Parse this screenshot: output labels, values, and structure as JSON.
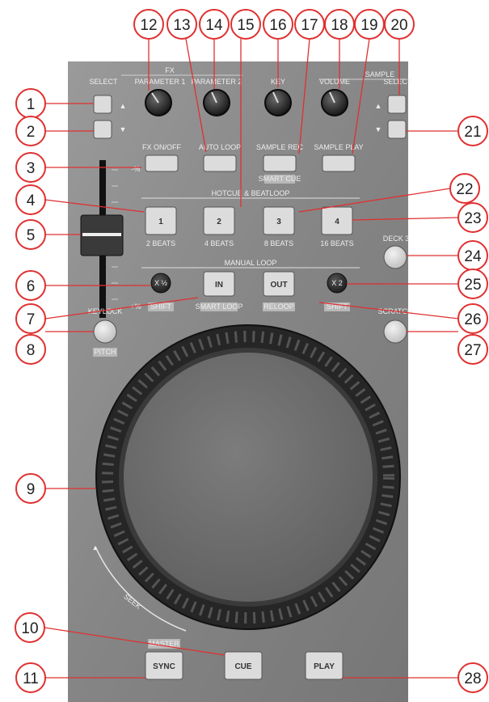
{
  "colors": {
    "panel": "#8a8a8a",
    "panel_dark": "#6f6f6f",
    "callout": "#e03030",
    "button": "#dcdcdc",
    "ring": "#2a2a2a",
    "platter": "#6e6e6e",
    "label_box": "#b8b8b8"
  },
  "sections": {
    "fx": "FX",
    "sample": "SAMPLE",
    "hotcue": "HOTCUE & BEATLOOP",
    "manual_loop": "MANUAL LOOP"
  },
  "labels": {
    "select_left": "SELECT",
    "select_right": "SELECT",
    "param1": "PARAMETER 1",
    "param2": "PARAMETER 2",
    "key": "KEY",
    "volume": "VOLUME",
    "fx_onoff": "FX ON/OFF",
    "auto_loop": "AUTO LOOP",
    "sample_rec": "SAMPLE REC",
    "sample_play": "SAMPLE PLAY",
    "smart_cue": "SMART CUE",
    "minus_pct": "-%",
    "plus_pct": "+%",
    "beats_2": "2 BEATS",
    "beats_4": "4 BEATS",
    "beats_8": "8 BEATS",
    "beats_16": "16 BEATS",
    "deck3": "DECK 3",
    "shift_left": "SHIFT",
    "smart_loop": "SMART LOOP",
    "reloop": "RELOOP",
    "shift_right": "SHIFT",
    "keylock": "KEYLOCK",
    "pitch": "PITCH",
    "scratch": "SCRATCH",
    "seek": "SEEK",
    "master": "MASTER"
  },
  "buttons": {
    "hot1": "1",
    "hot2": "2",
    "hot3": "3",
    "hot4": "4",
    "loop_half": "X ½",
    "loop_in": "IN",
    "loop_out": "OUT",
    "loop_double": "X 2",
    "sync": "SYNC",
    "cue": "CUE",
    "play": "PLAY"
  },
  "callouts": [
    "1",
    "2",
    "3",
    "4",
    "5",
    "6",
    "7",
    "8",
    "9",
    "10",
    "11",
    "12",
    "13",
    "14",
    "15",
    "16",
    "17",
    "18",
    "19",
    "20",
    "21",
    "22",
    "23",
    "24",
    "25",
    "26",
    "27",
    "28"
  ]
}
